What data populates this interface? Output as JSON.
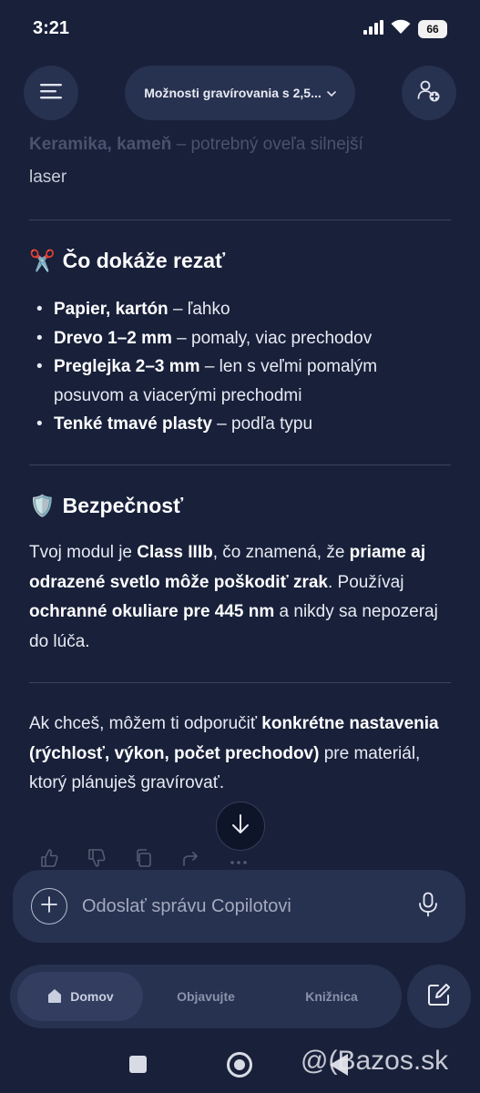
{
  "status_bar": {
    "time": "3:21",
    "battery": "66"
  },
  "header": {
    "title": "Možnosti gravírovania s 2,5..."
  },
  "content": {
    "faded_bold": "Keramika, kameň",
    "faded_rest": " – potrebný oveľa silnejší",
    "faded_continuation": "laser",
    "cut_section": {
      "emoji": "✂️",
      "heading": "Čo dokáže rezať",
      "items": [
        {
          "bold": "Papier, kartón",
          "rest": " – ľahko"
        },
        {
          "bold": "Drevo 1–2 mm",
          "rest": " – pomaly, viac prechodov"
        },
        {
          "bold": "Preglejka 2–3 mm",
          "rest": " – len s veľmi pomalým posuvom a viacerými prechodmi"
        },
        {
          "bold": "Tenké tmavé plasty",
          "rest": " – podľa typu"
        }
      ]
    },
    "safety_section": {
      "emoji": "🛡️",
      "heading": "Bezpečnosť",
      "p1": "Tvoj modul je ",
      "b1": "Class IIIb",
      "p2": ", čo znamená, že ",
      "b2": "priame aj odrazené svetlo môže poškodiť zrak",
      "p3": ". Používaj ",
      "b3": "ochranné okuliare pre 445 nm",
      "p4": " a nikdy sa nepozeraj do lúča."
    },
    "closing": {
      "p1": "Ak chceš, môžem ti odporučiť ",
      "b1": "konkrétne nastavenia (rýchlosť, výkon, počet prechodov)",
      "p2": " pre materiál, ktorý plánuješ gravírovať."
    }
  },
  "composer": {
    "placeholder": "Odoslať správu Copilotovi"
  },
  "bottom_nav": {
    "home": "Domov",
    "discover": "Objavujte",
    "library": "Knižnica"
  },
  "watermark": "@(Bazos.sk"
}
